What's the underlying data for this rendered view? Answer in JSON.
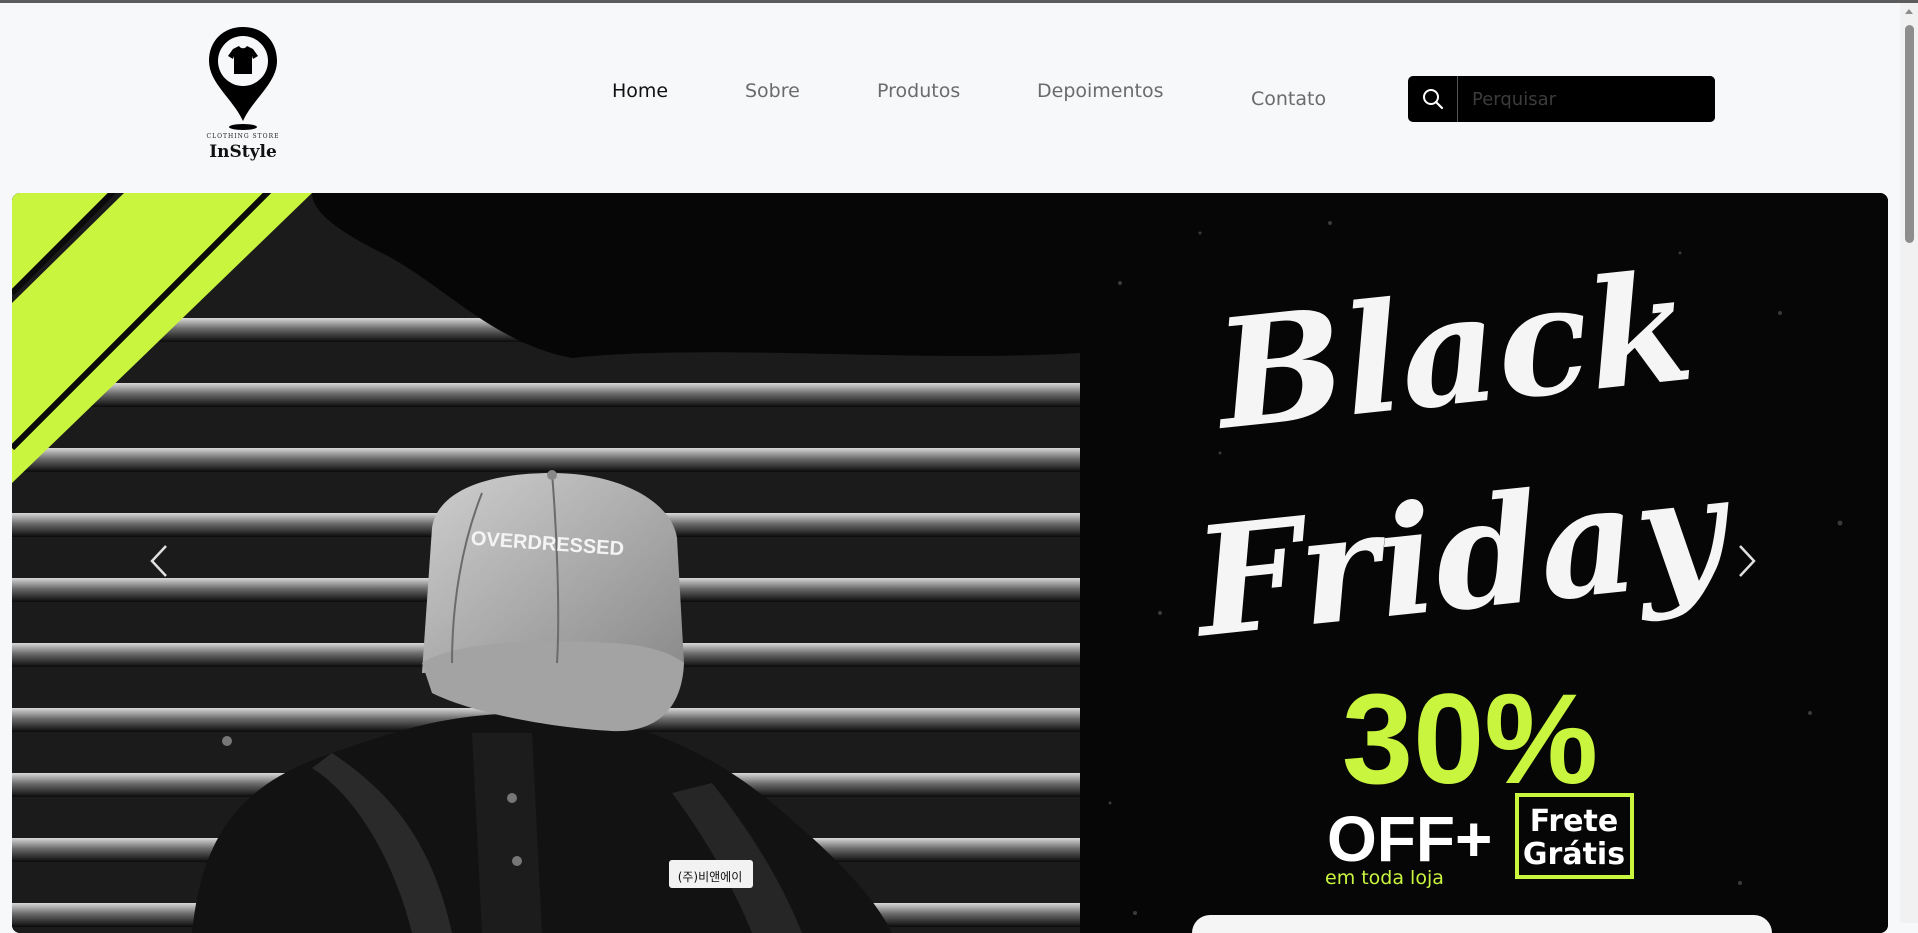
{
  "logo": {
    "tagline": "CLOTHING STORE",
    "brand": "InStyle"
  },
  "nav": {
    "items": [
      {
        "label": "Home",
        "active": true
      },
      {
        "label": "Sobre",
        "active": false
      },
      {
        "label": "Produtos",
        "active": false
      },
      {
        "label": "Depoimentos",
        "active": false
      },
      {
        "label": "Contato",
        "active": false
      }
    ]
  },
  "search": {
    "placeholder": "Perquisar",
    "icon": "search-icon"
  },
  "carousel": {
    "prev_icon": "chevron-left-icon",
    "next_icon": "chevron-right-icon",
    "slide": {
      "cap_text": "OVERDRESSED",
      "patch_text": "(주)비앤에이",
      "headline_line1": "Black",
      "headline_line2": "Friday",
      "discount": "30%",
      "off": "OFF+",
      "shipping_line1": "Frete",
      "shipping_line2": "Grátis",
      "subtext": "em toda loja"
    }
  },
  "colors": {
    "accent": "#c9f53f",
    "background": "#f7f8fa",
    "hero_bg": "#050505"
  }
}
